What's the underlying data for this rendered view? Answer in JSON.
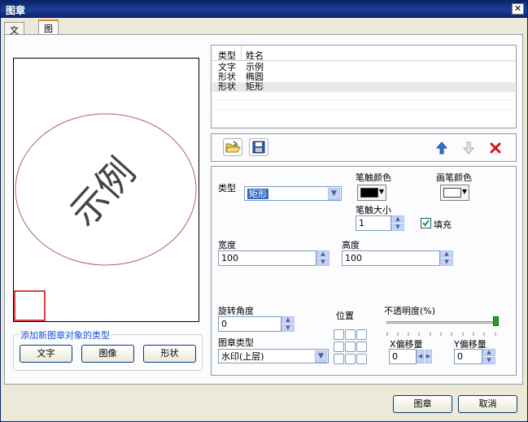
{
  "window": {
    "title": "图章"
  },
  "tabs": [
    {
      "label": "文件"
    },
    {
      "label": "图章"
    }
  ],
  "preview": {
    "stamp_text": "示例"
  },
  "add_group": {
    "legend": "添加新图章对象的类型",
    "buttons": [
      {
        "label": "文字"
      },
      {
        "label": "图像"
      },
      {
        "label": "形状"
      }
    ]
  },
  "object_list": {
    "headers": [
      "类型",
      "姓名"
    ],
    "rows": [
      {
        "type": "文字",
        "name": "示例"
      },
      {
        "type": "形状",
        "name": "椭圆"
      },
      {
        "type": "形状",
        "name": "矩形"
      }
    ]
  },
  "props": {
    "type_label": "类型",
    "type_value": "矩形",
    "pen_color_label": "笔触颜色",
    "pen_color": "#000000",
    "brush_color_label": "画笔颜色",
    "brush_color": "#ffffff",
    "pen_size_label": "笔触大小",
    "pen_size_value": "1",
    "fill_label": "填充",
    "width_label": "宽度",
    "width_value": "100",
    "height_label": "高度",
    "height_value": "100",
    "rotation_label": "旋转角度",
    "rotation_value": "0",
    "position_label": "位置",
    "opacity_label": "不透明度(%)",
    "stamp_type_label": "图章类型",
    "stamp_type_value": "水印(上层)",
    "x_offset_label": "X偏移量",
    "x_offset_value": "0",
    "y_offset_label": "Y偏移量",
    "y_offset_value": "0"
  },
  "footer": {
    "ok_label": "图章",
    "cancel_label": "取消"
  }
}
